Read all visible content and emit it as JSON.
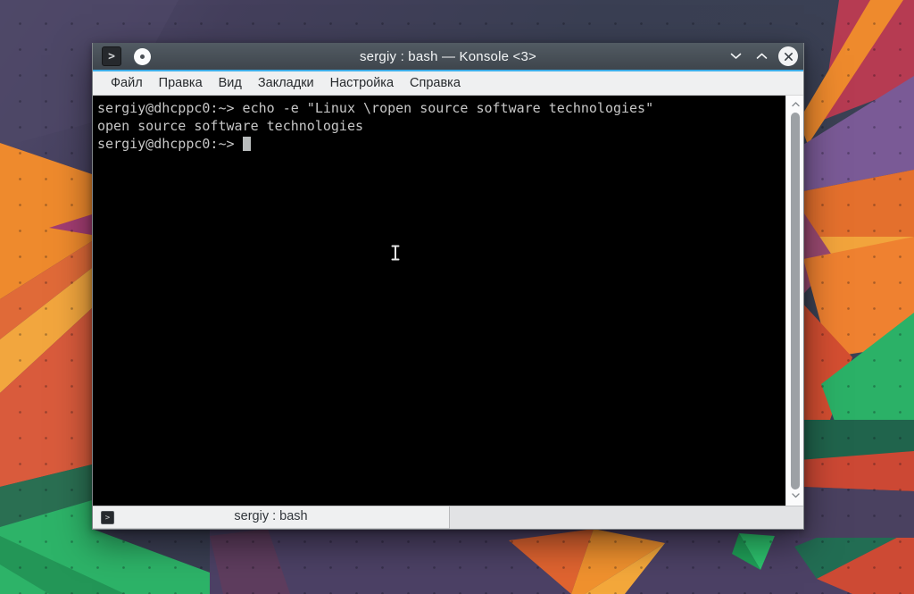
{
  "window": {
    "title": "sergiy : bash — Konsole <3>",
    "controls": {
      "minimize": "chevron-down",
      "maximize": "chevron-up",
      "close": "x-circle"
    }
  },
  "icons": {
    "app_icon_glyph": ">",
    "tab_icon_glyph": ">"
  },
  "menu": {
    "items": [
      {
        "label": "Файл"
      },
      {
        "label": "Правка"
      },
      {
        "label": "Вид"
      },
      {
        "label": "Закладки"
      },
      {
        "label": "Настройка"
      },
      {
        "label": "Справка"
      }
    ]
  },
  "terminal": {
    "prompt": "sergiy@dhcppc0:~>",
    "lines": [
      "sergiy@dhcppc0:~> echo -e \"Linux \\ropen source software technologies\"",
      "open source software technologies",
      "sergiy@dhcppc0:~> "
    ],
    "cursor_visible": true
  },
  "tabbar": {
    "active_tab": "sergiy : bash"
  },
  "colors": {
    "accent_blue": "#3daee9",
    "titlebar": "#49525a",
    "menubar_bg": "#eff0f1",
    "terminal_bg": "#000000",
    "terminal_fg": "#c7c7c7",
    "cursor": "#b9bcbd",
    "scroll_thumb": "#9da1a5",
    "tabbar_bg": "#e2e3e5"
  }
}
